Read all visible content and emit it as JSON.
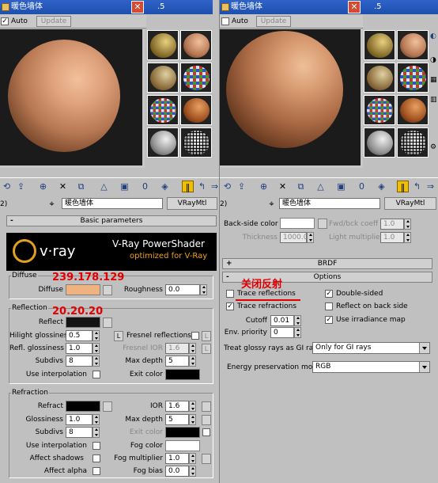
{
  "left": {
    "window_title": "暖色墙体",
    "auto_label": "Auto",
    "update_label": "Update",
    "close_glyph": "✕",
    "slot_tab_label": ".5",
    "material_name": "暖色墙体",
    "material_type": "VRayMtl",
    "row_label": "2)",
    "rollout_basic": "Basic parameters",
    "banner": {
      "logo": "v·ray",
      "title": "V-Ray PowerShader",
      "subtitle": "optimized for V-Ray"
    },
    "diffuse": {
      "group": "Diffuse",
      "label": "Diffuse",
      "color": "#efb281",
      "roughness_label": "Roughness",
      "roughness_value": "0.0"
    },
    "reflection": {
      "group": "Reflection",
      "reflect_label": "Reflect",
      "reflect_color": "#141414",
      "hilight_label": "Hilight glossiness",
      "hilight_value": "0.5",
      "l_label": "L",
      "fresnel_label": "Fresnel reflections",
      "refl_gloss_label": "Refl. glossiness",
      "refl_gloss_value": "1.0",
      "fresnel_ior_label": "Fresnel IOR",
      "fresnel_ior_value": "1.6",
      "subdivs_label": "Subdivs",
      "subdivs_value": "8",
      "max_depth_label": "Max depth",
      "max_depth_value": "5",
      "interp_label": "Use interpolation",
      "exit_color_label": "Exit color"
    },
    "refraction": {
      "group": "Refraction",
      "refract_label": "Refract",
      "ior_label": "IOR",
      "ior_value": "1.6",
      "gloss_label": "Glossiness",
      "gloss_value": "1.0",
      "max_depth_label": "Max depth",
      "max_depth_value": "5",
      "subdivs_label": "Subdivs",
      "subdivs_value": "8",
      "exit_color_label": "Exit color",
      "interp_label": "Use interpolation",
      "fog_color_label": "Fog color",
      "shadows_label": "Affect shadows",
      "fog_mult_label": "Fog multiplier",
      "fog_mult_value": "1.0",
      "alpha_label": "Affect alpha",
      "fog_bias_label": "Fog bias",
      "fog_bias_value": "0.0"
    },
    "annot_diffuse": "239.178.129",
    "annot_reflect": "20.20.20"
  },
  "right": {
    "window_title": "暖色墙体",
    "auto_label": "Auto",
    "update_label": "Update",
    "close_glyph": "✕",
    "slot_tab_label": ".5",
    "material_name": "暖色墙体",
    "material_type": "VRayMtl",
    "row_label": "2)",
    "backside_label": "Back-side color",
    "fwd_label": "Fwd/bck coeff",
    "fwd_value": "1.0",
    "thickness_label": "Thickness",
    "thickness_value": "1000.0",
    "light_mult_label": "Light multiplier",
    "light_mult_value": "1.0",
    "rollout_brdf": "BRDF",
    "rollout_options": "Options",
    "annot_options": "关闭反射",
    "trace_reflections": "Trace reflections",
    "double_sided": "Double-sided",
    "trace_refractions": "Trace refractions",
    "reflect_back": "Reflect on back side",
    "cutoff_label": "Cutoff",
    "cutoff_value": "0.01",
    "irr_map": "Use irradiance map",
    "env_priority_label": "Env. priority",
    "env_priority_value": "0",
    "glossy_gi_label": "Treat glossy rays as GI rays:",
    "glossy_gi_value": "Only for GI rays",
    "energy_label": "Energy preservation mode:",
    "energy_value": "RGB"
  },
  "check_glyph": "✓",
  "colors": {
    "accent_title": "#2f63c8",
    "annotation": "#e00000",
    "checker": "#ffffff"
  }
}
